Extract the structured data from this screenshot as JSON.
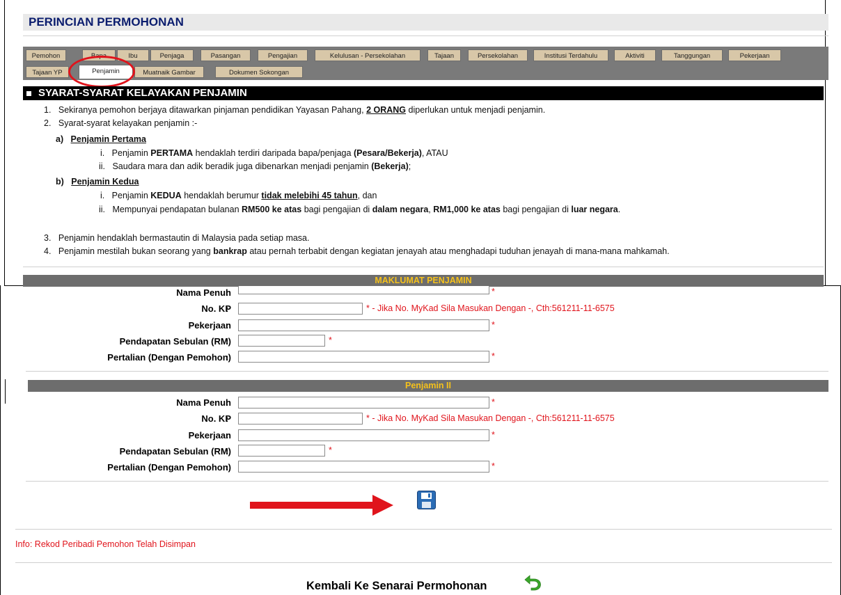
{
  "page_title": "PERINCIAN PERMOHONAN",
  "tabs_row1": [
    "Pemohon",
    "Bapa",
    "Ibu",
    "Penjaga",
    "Pasangan",
    "Pengajian",
    "Kelulusan - Persekolahan",
    "Tajaan",
    "Persekolahan",
    "Institusi Terdahulu",
    "Aktiviti",
    "Tanggungan",
    "Pekerjaan"
  ],
  "tabs_row2": [
    "Tajaan YP",
    "Penjamin",
    "Muatnaik Gambar",
    "Dokumen Sokongan"
  ],
  "active_tab": "Penjamin",
  "syarat": {
    "title": "SYARAT-SYARAT KELAYAKAN PENJAMIN",
    "n1": "1.",
    "l1a": "Sekiranya pemohon berjaya ditawarkan pinjaman pendidikan Yayasan Pahang,",
    "l1b": "2 ORANG",
    "l1c": "diperlukan untuk menjadi penjamin.",
    "n2": "2.",
    "l2": "Syarat-syarat kelayakan penjamin :-",
    "a_label": "a)",
    "a_title": "Penjamin Pertama",
    "ai_n": "i.",
    "ai_a": "Penjamin",
    "ai_b": "PERTAMA",
    "ai_c": "hendaklah terdiri daripada bapa/penjaga",
    "ai_d": "(Pesara/Bekerja)",
    "ai_e": ", ATAU",
    "aii_n": "ii.",
    "aii_a": "Saudara mara dan adik beradik juga dibenarkan menjadi penjamin",
    "aii_b": "(Bekerja)",
    "aii_c": ";",
    "b_label": "b)",
    "b_title": "Penjamin Kedua",
    "bi_n": "i.",
    "bi_a": "Penjamin",
    "bi_b": "KEDUA",
    "bi_c": "hendaklah berumur",
    "bi_d": "tidak melebihi 45 tahun",
    "bi_e": ", dan",
    "bii_n": "ii.",
    "bii_a": "Mempunyai pendapatan bulanan",
    "bii_b": "RM500 ke atas",
    "bii_c": "bagi pengajian di",
    "bii_d": "dalam negara",
    "bii_e": ",",
    "bii_f": "RM1,000 ke atas",
    "bii_g": "bagi pengajian di",
    "bii_h": "luar negara",
    "bii_i": ".",
    "n3": "3.",
    "l3": "Penjamin hendaklah bermastautin di Malaysia pada setiap masa.",
    "n4": "4.",
    "l4a": "Penjamin mestilah bukan seorang yang",
    "l4b": "bankrap",
    "l4c": "atau pernah terbabit dengan kegiatan jenayah atau menghadapi tuduhan jenayah di mana-mana mahkamah."
  },
  "section1_title": "MAKLUMAT PENJAMIN",
  "section2_title": "Penjamin II",
  "labels": {
    "nama": "Nama Penuh",
    "nokp": "No. KP",
    "pekerjaan": "Pekerjaan",
    "pendapatan": "Pendapatan Sebulan (RM)",
    "pertalian": "Pertalian (Dengan Pemohon)",
    "colon": ":"
  },
  "required_mark": "*",
  "nokp_hint": "* - Jika No. MyKad Sila Masukan Dengan -, Cth:561211-11-6575",
  "info_text": "Info: Rekod Peribadi Pemohon Telah Disimpan",
  "back_link": "Kembali Ke Senarai Permohonan",
  "icons": {
    "save": "save-icon",
    "back": "back-arrow-icon"
  },
  "colors": {
    "header_text": "#0b1d6e",
    "section_text": "#f5c11b",
    "required": "#e0141c",
    "tab_bg": "#d8c7a8"
  }
}
